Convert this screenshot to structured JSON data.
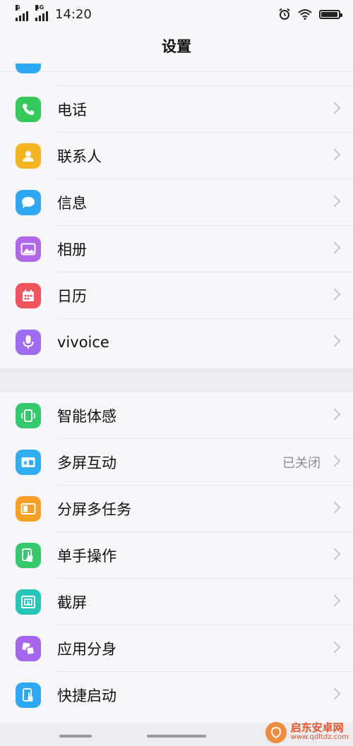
{
  "status_bar": {
    "network_top_1": "G",
    "network_top_2": "4G",
    "time": "14:20",
    "battery_level": 0.95,
    "icons": [
      "signal-icon",
      "signal-icon",
      "alarm-icon",
      "wifi-icon",
      "battery-icon"
    ]
  },
  "header": {
    "title": "设置"
  },
  "group1": [
    {
      "label": "电话",
      "icon": "phone-icon",
      "color": "#34c759"
    },
    {
      "label": "联系人",
      "icon": "contact-icon",
      "color": "#f5b51e"
    },
    {
      "label": "信息",
      "icon": "message-icon",
      "color": "#2ea8f5"
    },
    {
      "label": "相册",
      "icon": "album-icon",
      "color": "#b067e8"
    },
    {
      "label": "日历",
      "icon": "calendar-icon",
      "color": "#f0545a"
    },
    {
      "label": "vivoice",
      "icon": "microphone-icon",
      "color": "#9d6cf0"
    }
  ],
  "group2": [
    {
      "label": "智能体感",
      "icon": "motion-icon",
      "color": "#35c96e"
    },
    {
      "label": "多屏互动",
      "icon": "screen-cast-icon",
      "color": "#2eaef0",
      "value": "已关闭"
    },
    {
      "label": "分屏多任务",
      "icon": "split-screen-icon",
      "color": "#f7a024"
    },
    {
      "label": "单手操作",
      "icon": "one-hand-icon",
      "color": "#35c96e"
    },
    {
      "label": "截屏",
      "icon": "screenshot-icon",
      "color": "#27c4b9"
    },
    {
      "label": "应用分身",
      "icon": "app-clone-icon",
      "color": "#a565ec"
    },
    {
      "label": "快捷启动",
      "icon": "quick-launch-icon",
      "color": "#2ea8f5"
    }
  ],
  "watermark": {
    "name": "启东安卓网",
    "url": "www.qdltdz.com"
  }
}
